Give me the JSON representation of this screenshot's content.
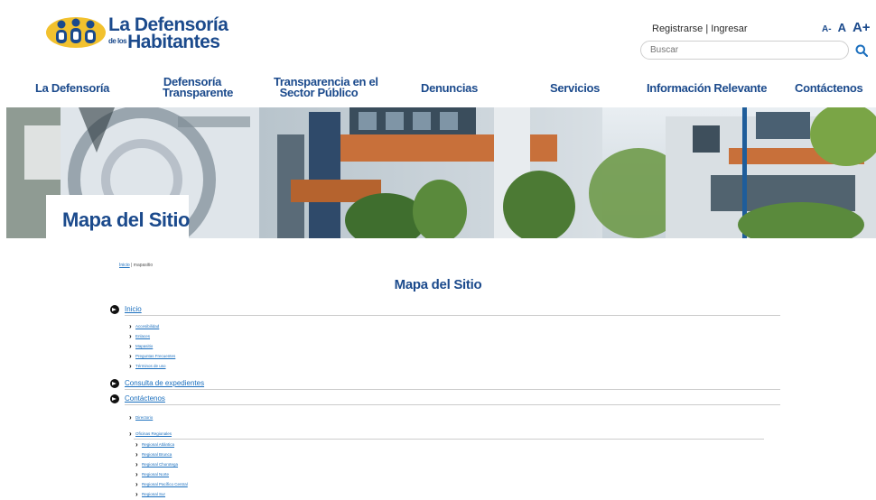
{
  "header": {
    "logo_line1": "La Defensoría",
    "logo_line2_small": "de los",
    "logo_line2": "Habitantes",
    "register": "Registrarse",
    "separator": "|",
    "login": "Ingresar",
    "font_small": "A-",
    "font_normal": "A",
    "font_large": "A+",
    "search_placeholder": "Buscar"
  },
  "nav": [
    {
      "line1": "La Defensoría",
      "line2": ""
    },
    {
      "line1": "Defensoría",
      "line2": "Transparente"
    },
    {
      "line1": "Transparencia en el",
      "line2": "Sector Público"
    },
    {
      "line1": "Denuncias",
      "line2": ""
    },
    {
      "line1": "Servicios",
      "line2": ""
    },
    {
      "line1": "Información Relevante",
      "line2": ""
    },
    {
      "line1": "Contáctenos",
      "line2": ""
    }
  ],
  "banner": {
    "title": "Mapa del Sitio"
  },
  "breadcrumb": {
    "home": "Inicio",
    "separator": "|",
    "current": "mapasitio"
  },
  "main": {
    "title": "Mapa del Sitio",
    "sections": [
      {
        "label": "Inicio"
      },
      {
        "label": "Consulta de expedientes"
      },
      {
        "label": "Contáctenos"
      }
    ],
    "inicio_items": [
      "Accesibilidad",
      "Enlaces",
      "Mapasitio",
      "Preguntas Frecuentes",
      "Términos de uso"
    ],
    "contactenos_items": [
      "Directorio",
      "Oficinas Regionales"
    ],
    "regional_items": [
      "Regional Atlántica",
      "Regional Brunca",
      "Regional Chorotega",
      "Regional Norte",
      "Regional Pacífico Central",
      "Regional Sur"
    ]
  },
  "colors": {
    "brand_blue": "#1b4a8c",
    "link_blue": "#1b6fbe",
    "logo_yellow": "#f2c12e"
  }
}
